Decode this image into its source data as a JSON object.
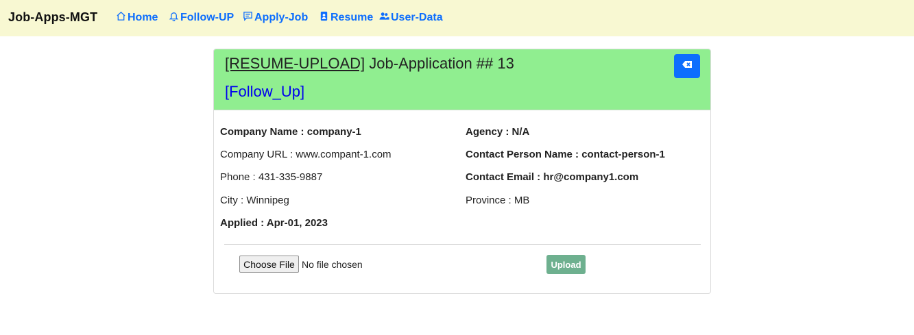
{
  "navbar": {
    "brand": "Job-Apps-MGT",
    "items": [
      {
        "label": "Home",
        "icon": "house-icon"
      },
      {
        "label": "Follow-UP",
        "icon": "bell-icon"
      },
      {
        "label": "Apply-Job",
        "icon": "chat-square-text-icon"
      },
      {
        "label": "Resume",
        "icon": "person-badge-icon"
      },
      {
        "label": "User-Data",
        "icon": "people-icon"
      }
    ],
    "link_color": "#0d6efd",
    "background": "#f8f8d2"
  },
  "card": {
    "header_bg": "#90ee90",
    "title_link": "[RESUME-UPLOAD]",
    "title_rest": " Job-Application ## 13",
    "follow_up": "[Follow_Up]",
    "delete_icon": "backspace-icon",
    "left_fields": [
      "Company Name : company-1",
      "Company URL : www.compant-1.com",
      "Phone : 431-335-9887",
      "City : Winnipeg",
      "Applied : Apr-01, 2023"
    ],
    "right_fields": [
      "Agency : N/A",
      "Contact Person Name : contact-person-1",
      "Contact Email : hr@company1.com",
      "Province : MB"
    ],
    "file": {
      "choose_label": "Choose File",
      "status": "No file chosen"
    },
    "upload_label": "Upload",
    "upload_color": "#6eb08f"
  }
}
